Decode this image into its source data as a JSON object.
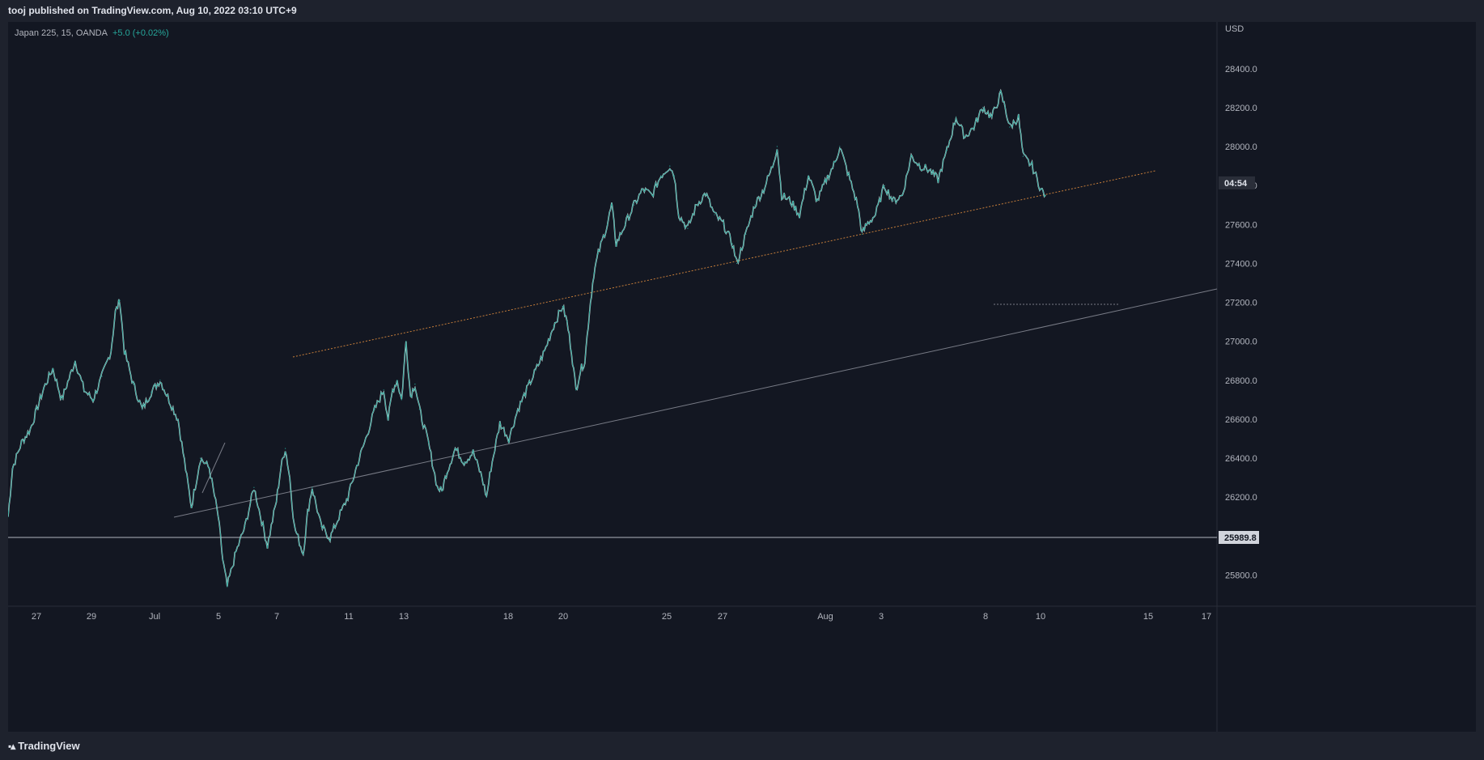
{
  "header": {
    "publisher": "tooj published on TradingView.com, Aug 10, 2022 03:10 UTC+9"
  },
  "legend": {
    "symbol": "Japan 225, 15, OANDA",
    "change": "+5.0 (+0.02%)"
  },
  "footer": {
    "brand": "TradingView",
    "brand_icon": "tradingview-logo-icon"
  },
  "colors": {
    "background": "#131722",
    "frame": "#1e222d",
    "series": "#26a69a",
    "wick": "#ffffff",
    "trendline": "#c57d3a",
    "channel": "#787b86",
    "level": "#b2b5be"
  },
  "chart_data": {
    "type": "line",
    "symbol": "Japan 225",
    "interval": "15",
    "broker": "OANDA",
    "currency": "USD",
    "x_ticks": [
      "27",
      "29",
      "Jul",
      "5",
      "7",
      "11",
      "13",
      "18",
      "20",
      "25",
      "27",
      "Aug",
      "3",
      "8",
      "10",
      "15",
      "17"
    ],
    "y_ticks": [
      "25800.0",
      "26000.0",
      "26200.0",
      "26400.0",
      "26600.0",
      "26800.0",
      "27000.0",
      "27200.0",
      "27400.0",
      "27600.0",
      "27800.0",
      "28000.0",
      "28200.0",
      "28400.0"
    ],
    "ylim": [
      25640,
      28640
    ],
    "grid": false,
    "series": [
      {
        "values": [
          [
            0,
            26100
          ],
          [
            1,
            26350
          ],
          [
            3,
            26480
          ],
          [
            5,
            26550
          ],
          [
            8,
            26760
          ],
          [
            10,
            26860
          ],
          [
            12,
            26700
          ],
          [
            15,
            26900
          ],
          [
            17,
            26750
          ],
          [
            19,
            26700
          ],
          [
            21,
            26820
          ],
          [
            23,
            26950
          ],
          [
            24,
            27150
          ],
          [
            25,
            27210
          ],
          [
            26,
            26950
          ],
          [
            28,
            26780
          ],
          [
            30,
            26650
          ],
          [
            32,
            26740
          ],
          [
            34,
            26800
          ],
          [
            36,
            26700
          ],
          [
            38,
            26600
          ],
          [
            40,
            26300
          ],
          [
            41,
            26150
          ],
          [
            43,
            26400
          ],
          [
            45,
            26350
          ],
          [
            47,
            26100
          ],
          [
            48,
            25880
          ],
          [
            49,
            25740
          ],
          [
            51,
            25920
          ],
          [
            53,
            26050
          ],
          [
            55,
            26250
          ],
          [
            57,
            26050
          ],
          [
            58,
            25950
          ],
          [
            60,
            26180
          ],
          [
            61,
            26350
          ],
          [
            62,
            26450
          ],
          [
            63,
            26300
          ],
          [
            64,
            26050
          ],
          [
            66,
            25910
          ],
          [
            67,
            26120
          ],
          [
            68,
            26250
          ],
          [
            70,
            26050
          ],
          [
            72,
            25990
          ],
          [
            74,
            26100
          ],
          [
            76,
            26200
          ],
          [
            78,
            26360
          ],
          [
            80,
            26500
          ],
          [
            82,
            26650
          ],
          [
            84,
            26750
          ],
          [
            85,
            26600
          ],
          [
            86,
            26750
          ],
          [
            87,
            26800
          ],
          [
            88,
            26700
          ],
          [
            89,
            27000
          ],
          [
            90,
            26720
          ],
          [
            91,
            26780
          ],
          [
            92,
            26650
          ],
          [
            94,
            26480
          ],
          [
            96,
            26250
          ],
          [
            97,
            26230
          ],
          [
            98,
            26320
          ],
          [
            100,
            26450
          ],
          [
            102,
            26380
          ],
          [
            104,
            26430
          ],
          [
            106,
            26300
          ],
          [
            107,
            26200
          ],
          [
            108,
            26350
          ],
          [
            110,
            26580
          ],
          [
            112,
            26500
          ],
          [
            114,
            26650
          ],
          [
            116,
            26750
          ],
          [
            118,
            26850
          ],
          [
            120,
            26950
          ],
          [
            122,
            27080
          ],
          [
            124,
            27180
          ],
          [
            125,
            27100
          ],
          [
            126,
            26950
          ],
          [
            127,
            26750
          ],
          [
            128,
            26850
          ],
          [
            129,
            26900
          ],
          [
            130,
            27150
          ],
          [
            131,
            27350
          ],
          [
            132,
            27450
          ],
          [
            134,
            27600
          ],
          [
            135,
            27700
          ],
          [
            136,
            27500
          ],
          [
            138,
            27600
          ],
          [
            140,
            27700
          ],
          [
            142,
            27780
          ],
          [
            144,
            27750
          ],
          [
            146,
            27850
          ],
          [
            148,
            27900
          ],
          [
            149,
            27850
          ],
          [
            150,
            27650
          ],
          [
            152,
            27580
          ],
          [
            154,
            27700
          ],
          [
            156,
            27760
          ],
          [
            158,
            27650
          ],
          [
            160,
            27600
          ],
          [
            162,
            27500
          ],
          [
            163,
            27400
          ],
          [
            165,
            27550
          ],
          [
            167,
            27700
          ],
          [
            169,
            27780
          ],
          [
            171,
            27900
          ],
          [
            172,
            28000
          ],
          [
            173,
            27750
          ],
          [
            175,
            27720
          ],
          [
            177,
            27650
          ],
          [
            179,
            27850
          ],
          [
            181,
            27720
          ],
          [
            183,
            27830
          ],
          [
            185,
            27920
          ],
          [
            186,
            28000
          ],
          [
            188,
            27850
          ],
          [
            190,
            27700
          ],
          [
            191,
            27550
          ],
          [
            192,
            27600
          ],
          [
            194,
            27650
          ],
          [
            196,
            27800
          ],
          [
            198,
            27720
          ],
          [
            200,
            27750
          ],
          [
            202,
            27950
          ],
          [
            204,
            27900
          ],
          [
            206,
            27880
          ],
          [
            208,
            27830
          ],
          [
            210,
            27980
          ],
          [
            212,
            28150
          ],
          [
            214,
            28050
          ],
          [
            216,
            28100
          ],
          [
            218,
            28200
          ],
          [
            220,
            28150
          ],
          [
            222,
            28270
          ],
          [
            223,
            28200
          ],
          [
            224,
            28100
          ],
          [
            226,
            28150
          ],
          [
            227,
            27950
          ],
          [
            229,
            27900
          ],
          [
            231,
            27780
          ],
          [
            232,
            27750
          ]
        ]
      }
    ],
    "annotations": {
      "current_price_label": "25989.8",
      "countdown_label": "04:54"
    }
  }
}
